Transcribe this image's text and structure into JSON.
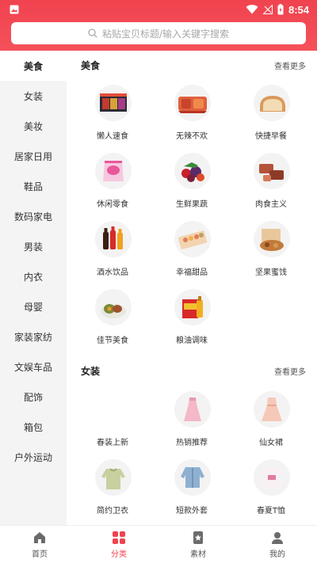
{
  "status_bar": {
    "time": "8:54"
  },
  "search": {
    "placeholder": "粘贴宝贝标题/输入关键字搜索"
  },
  "sidebar": {
    "items": [
      "美食",
      "女装",
      "美妆",
      "居家日用",
      "鞋品",
      "数码家电",
      "男装",
      "内衣",
      "母婴",
      "家装家纺",
      "文娱车品",
      "配饰",
      "箱包",
      "户外运动"
    ],
    "active_index": 0
  },
  "sections": [
    {
      "title": "美食",
      "more": "查看更多",
      "items": [
        "懒人速食",
        "无辣不欢",
        "快捷早餐",
        "休闲零食",
        "生鲜果蔬",
        "肉食主义",
        "酒水饮品",
        "幸福甜品",
        "坚果蜜饯",
        "佳节美食",
        "粮油调味"
      ]
    },
    {
      "title": "女装",
      "more": "查看更多",
      "items": [
        "春装上新",
        "热销推荐",
        "仙女裙",
        "简约卫衣",
        "短款外套",
        "春夏T恤"
      ]
    }
  ],
  "tabbar": {
    "items": [
      "首页",
      "分类",
      "素材",
      "我的"
    ],
    "active_index": 1
  },
  "colors": {
    "accent": "#f0434f",
    "sidebar_bg": "#f4f4f4"
  },
  "icons": [
    "image-icon",
    "wifi-icon",
    "signal-icon",
    "battery-icon",
    "search-icon",
    "home-icon",
    "category-icon",
    "material-icon",
    "user-icon"
  ]
}
